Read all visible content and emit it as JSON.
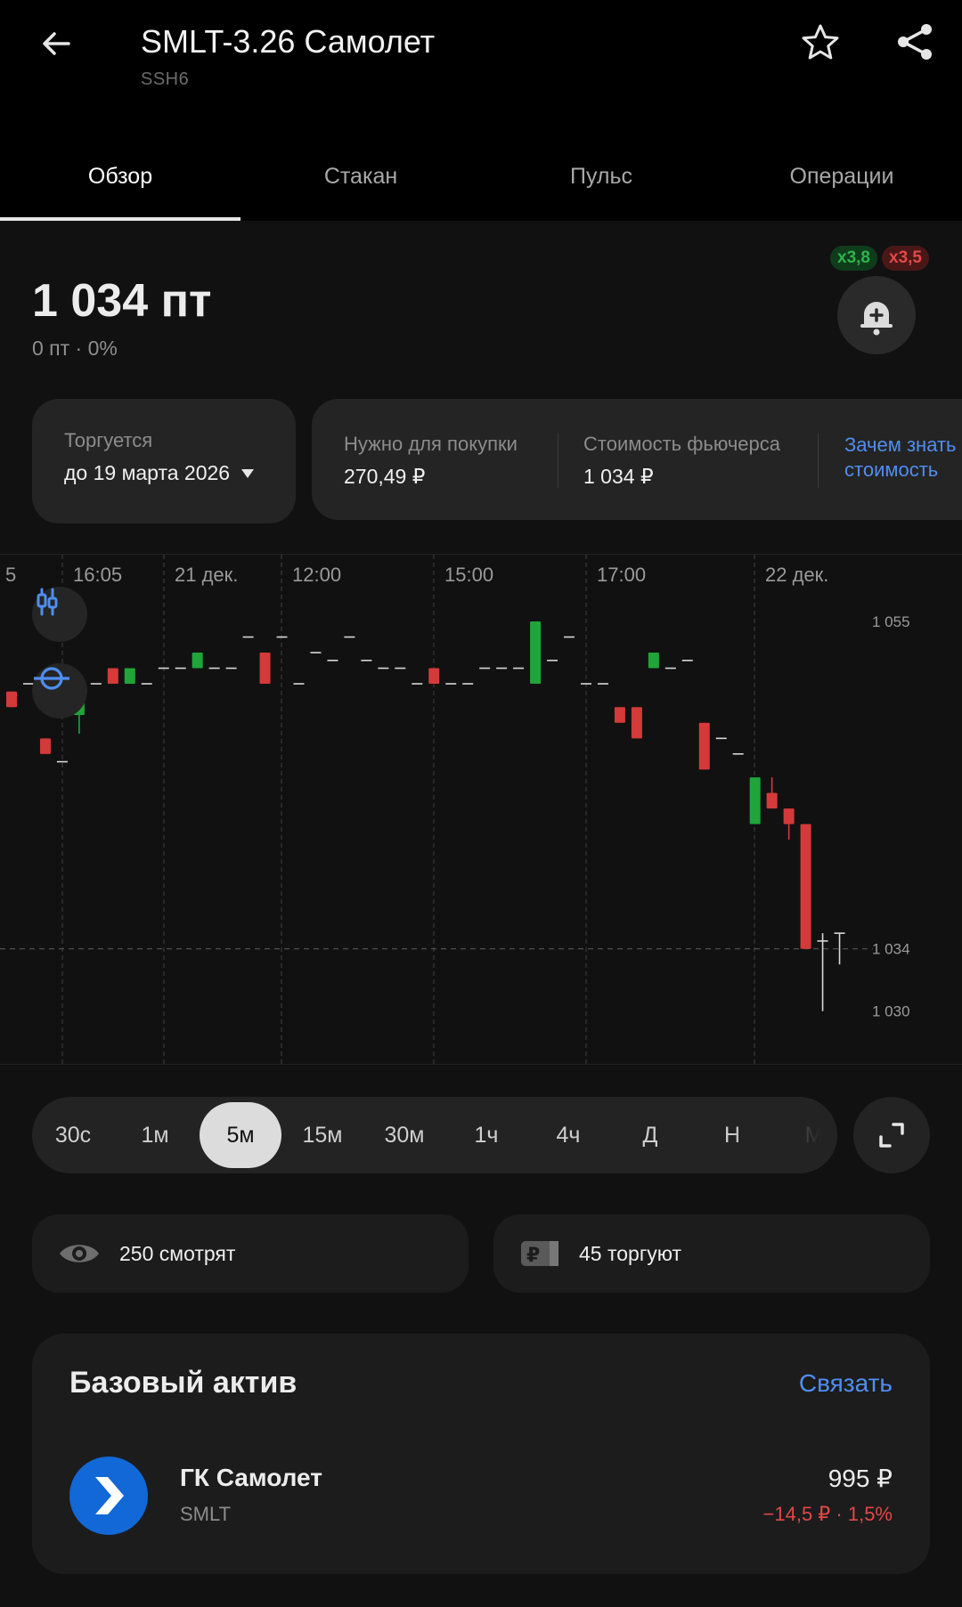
{
  "header": {
    "title": "SMLT-3.26 Самолет",
    "subtitle": "SSH6",
    "icons": {
      "back": "arrow-left-icon",
      "favorite": "star-outline-icon",
      "share": "share-icon"
    }
  },
  "tabs": [
    {
      "label": "Обзор",
      "active": true
    },
    {
      "label": "Стакан",
      "active": false
    },
    {
      "label": "Пульс",
      "active": false
    },
    {
      "label": "Операции",
      "active": false
    }
  ],
  "quote": {
    "price": "1 034 пт",
    "change": "0 пт · 0%",
    "multiplier_long": "x3,8",
    "multiplier_short": "x3,5",
    "colors": {
      "long": "#2fb34b",
      "short": "#e24848"
    }
  },
  "trading": {
    "label": "Торгуется",
    "value": "до 19 марта 2026"
  },
  "info": {
    "need_label": "Нужно для покупки",
    "need_value": "270,49 ₽",
    "cost_label": "Стоимость фьючерса",
    "cost_value": "1 034 ₽",
    "link": "Зачем знать стоимость"
  },
  "chart_data": {
    "type": "candlestick",
    "time_labels": [
      "5",
      "16:05",
      "21 дек.",
      "12:00",
      "15:00",
      "17:00",
      "22 дек."
    ],
    "price_labels": [
      "1 055",
      "1 034",
      "1 030"
    ],
    "ylim": [
      1026.5,
      1057
    ],
    "current_price": 1034,
    "grid": true,
    "colors": {
      "up": "#1fa53a",
      "down": "#d43a3a",
      "flat": "#d8d8d8"
    },
    "candles": [
      {
        "i": 0,
        "o": 1050.5,
        "h": 1050.5,
        "l": 1049.5,
        "c": 1049.5
      },
      {
        "i": 1,
        "o": 1051,
        "h": 1051,
        "l": 1051,
        "c": 1051
      },
      {
        "i": 2,
        "o": 1047.5,
        "h": 1047.5,
        "l": 1046.5,
        "c": 1046.5
      },
      {
        "i": 3,
        "o": 1046,
        "h": 1046,
        "l": 1046,
        "c": 1046
      },
      {
        "i": 4,
        "o": 1049,
        "h": 1051,
        "l": 1047.8,
        "c": 1051
      },
      {
        "i": 5,
        "o": 1051,
        "h": 1051,
        "l": 1051,
        "c": 1051
      },
      {
        "i": 6,
        "o": 1052,
        "h": 1052,
        "l": 1051,
        "c": 1051
      },
      {
        "i": 7,
        "o": 1051,
        "h": 1052,
        "l": 1051,
        "c": 1052
      },
      {
        "i": 8,
        "o": 1051,
        "h": 1051,
        "l": 1051,
        "c": 1051
      },
      {
        "i": 9,
        "o": 1052,
        "h": 1052,
        "l": 1052,
        "c": 1052
      },
      {
        "i": 10,
        "o": 1052,
        "h": 1052,
        "l": 1052,
        "c": 1052
      },
      {
        "i": 11,
        "o": 1052,
        "h": 1053,
        "l": 1052,
        "c": 1053
      },
      {
        "i": 12,
        "o": 1052,
        "h": 1052,
        "l": 1052,
        "c": 1052
      },
      {
        "i": 13,
        "o": 1052,
        "h": 1052,
        "l": 1052,
        "c": 1052
      },
      {
        "i": 14,
        "o": 1054,
        "h": 1054,
        "l": 1054,
        "c": 1054
      },
      {
        "i": 15,
        "o": 1053,
        "h": 1053,
        "l": 1051,
        "c": 1051
      },
      {
        "i": 16,
        "o": 1054,
        "h": 1054,
        "l": 1054,
        "c": 1054
      },
      {
        "i": 17,
        "o": 1051,
        "h": 1051,
        "l": 1051,
        "c": 1051
      },
      {
        "i": 18,
        "o": 1053,
        "h": 1053,
        "l": 1053,
        "c": 1053
      },
      {
        "i": 19,
        "o": 1052.5,
        "h": 1052.5,
        "l": 1052.5,
        "c": 1052.5
      },
      {
        "i": 20,
        "o": 1054,
        "h": 1054,
        "l": 1054,
        "c": 1054
      },
      {
        "i": 21,
        "o": 1052.5,
        "h": 1052.5,
        "l": 1052.5,
        "c": 1052.5
      },
      {
        "i": 22,
        "o": 1052,
        "h": 1052,
        "l": 1052,
        "c": 1052
      },
      {
        "i": 23,
        "o": 1052,
        "h": 1052,
        "l": 1052,
        "c": 1052
      },
      {
        "i": 24,
        "o": 1051,
        "h": 1051,
        "l": 1051,
        "c": 1051
      },
      {
        "i": 25,
        "o": 1052,
        "h": 1052,
        "l": 1051,
        "c": 1051
      },
      {
        "i": 26,
        "o": 1051,
        "h": 1051,
        "l": 1051,
        "c": 1051
      },
      {
        "i": 27,
        "o": 1051,
        "h": 1051,
        "l": 1051,
        "c": 1051
      },
      {
        "i": 28,
        "o": 1052,
        "h": 1052,
        "l": 1052,
        "c": 1052
      },
      {
        "i": 29,
        "o": 1052,
        "h": 1052,
        "l": 1052,
        "c": 1052
      },
      {
        "i": 30,
        "o": 1052,
        "h": 1052,
        "l": 1052,
        "c": 1052
      },
      {
        "i": 31,
        "o": 1051,
        "h": 1055,
        "l": 1051,
        "c": 1055
      },
      {
        "i": 32,
        "o": 1052.5,
        "h": 1052.5,
        "l": 1052.5,
        "c": 1052.5
      },
      {
        "i": 33,
        "o": 1054,
        "h": 1054,
        "l": 1054,
        "c": 1054
      },
      {
        "i": 34,
        "o": 1051,
        "h": 1051,
        "l": 1051,
        "c": 1051
      },
      {
        "i": 35,
        "o": 1051,
        "h": 1051,
        "l": 1051,
        "c": 1051
      },
      {
        "i": 36,
        "o": 1049.5,
        "h": 1049.5,
        "l": 1048.5,
        "c": 1048.5
      },
      {
        "i": 37,
        "o": 1049.5,
        "h": 1049.5,
        "l": 1047.5,
        "c": 1047.5
      },
      {
        "i": 38,
        "o": 1052,
        "h": 1053,
        "l": 1052,
        "c": 1053
      },
      {
        "i": 39,
        "o": 1052,
        "h": 1052,
        "l": 1052,
        "c": 1052
      },
      {
        "i": 40,
        "o": 1052.5,
        "h": 1052.5,
        "l": 1052.5,
        "c": 1052.5
      },
      {
        "i": 41,
        "o": 1048.5,
        "h": 1048.5,
        "l": 1045.5,
        "c": 1045.5
      },
      {
        "i": 42,
        "o": 1047.5,
        "h": 1047.5,
        "l": 1047.5,
        "c": 1047.5
      },
      {
        "i": 43,
        "o": 1046.5,
        "h": 1046.5,
        "l": 1046.5,
        "c": 1046.5
      },
      {
        "i": 44,
        "o": 1042,
        "h": 1045,
        "l": 1042,
        "c": 1045
      },
      {
        "i": 45,
        "o": 1044,
        "h": 1045,
        "l": 1043,
        "c": 1043
      },
      {
        "i": 46,
        "o": 1043,
        "h": 1043,
        "l": 1041,
        "c": 1042
      },
      {
        "i": 47,
        "o": 1042,
        "h": 1042,
        "l": 1034,
        "c": 1034
      },
      {
        "i": 48,
        "o": 1034.5,
        "h": 1035,
        "l": 1030,
        "c": 1034.5
      },
      {
        "i": 49,
        "o": 1035,
        "h": 1035,
        "l": 1033,
        "c": 1035
      }
    ]
  },
  "chart_tools": {
    "indicators_icon": "indicators-icon",
    "crosshair_icon": "crosshair-icon"
  },
  "timeframes": {
    "items": [
      "30с",
      "1м",
      "5м",
      "15м",
      "30м",
      "1ч",
      "4ч",
      "Д",
      "Н",
      "М"
    ],
    "selected": "5м",
    "fullscreen_icon": "fullscreen-icon"
  },
  "stats": {
    "watching": "250 смотрят",
    "trading": "45 торгуют",
    "watching_icon": "eye-icon",
    "trading_icon": "ruble-chip-icon"
  },
  "underlying": {
    "title": "Базовый актив",
    "link": "Связать",
    "name": "ГК Самолет",
    "ticker": "SMLT",
    "price": "995 ₽",
    "change": "−14,5 ₽ · 1,5%",
    "logo_color": "#1168d6"
  }
}
